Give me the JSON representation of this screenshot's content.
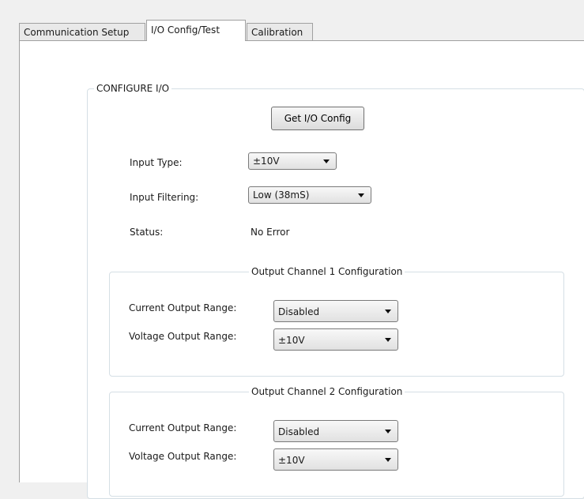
{
  "tabs": [
    {
      "label": "Communication Setup",
      "active": false
    },
    {
      "label": "I/O Config/Test",
      "active": true
    },
    {
      "label": "Calibration",
      "active": false
    }
  ],
  "configure_io": {
    "title": "CONFIGURE I/O",
    "get_config_button": "Get I/O Config",
    "input_type": {
      "label": "Input Type:",
      "value": "±10V"
    },
    "input_filtering": {
      "label": "Input Filtering:",
      "value": "Low (38mS)"
    },
    "status": {
      "label": "Status:",
      "value": "No Error"
    }
  },
  "output_channels": [
    {
      "title": "Output Channel 1 Configuration",
      "current_range": {
        "label": "Current Output Range:",
        "value": "Disabled"
      },
      "voltage_range": {
        "label": "Voltage Output Range:",
        "value": "±10V"
      }
    },
    {
      "title": "Output Channel 2 Configuration",
      "current_range": {
        "label": "Current Output Range:",
        "value": "Disabled"
      },
      "voltage_range": {
        "label": "Voltage Output Range:",
        "value": "±10V"
      }
    }
  ]
}
